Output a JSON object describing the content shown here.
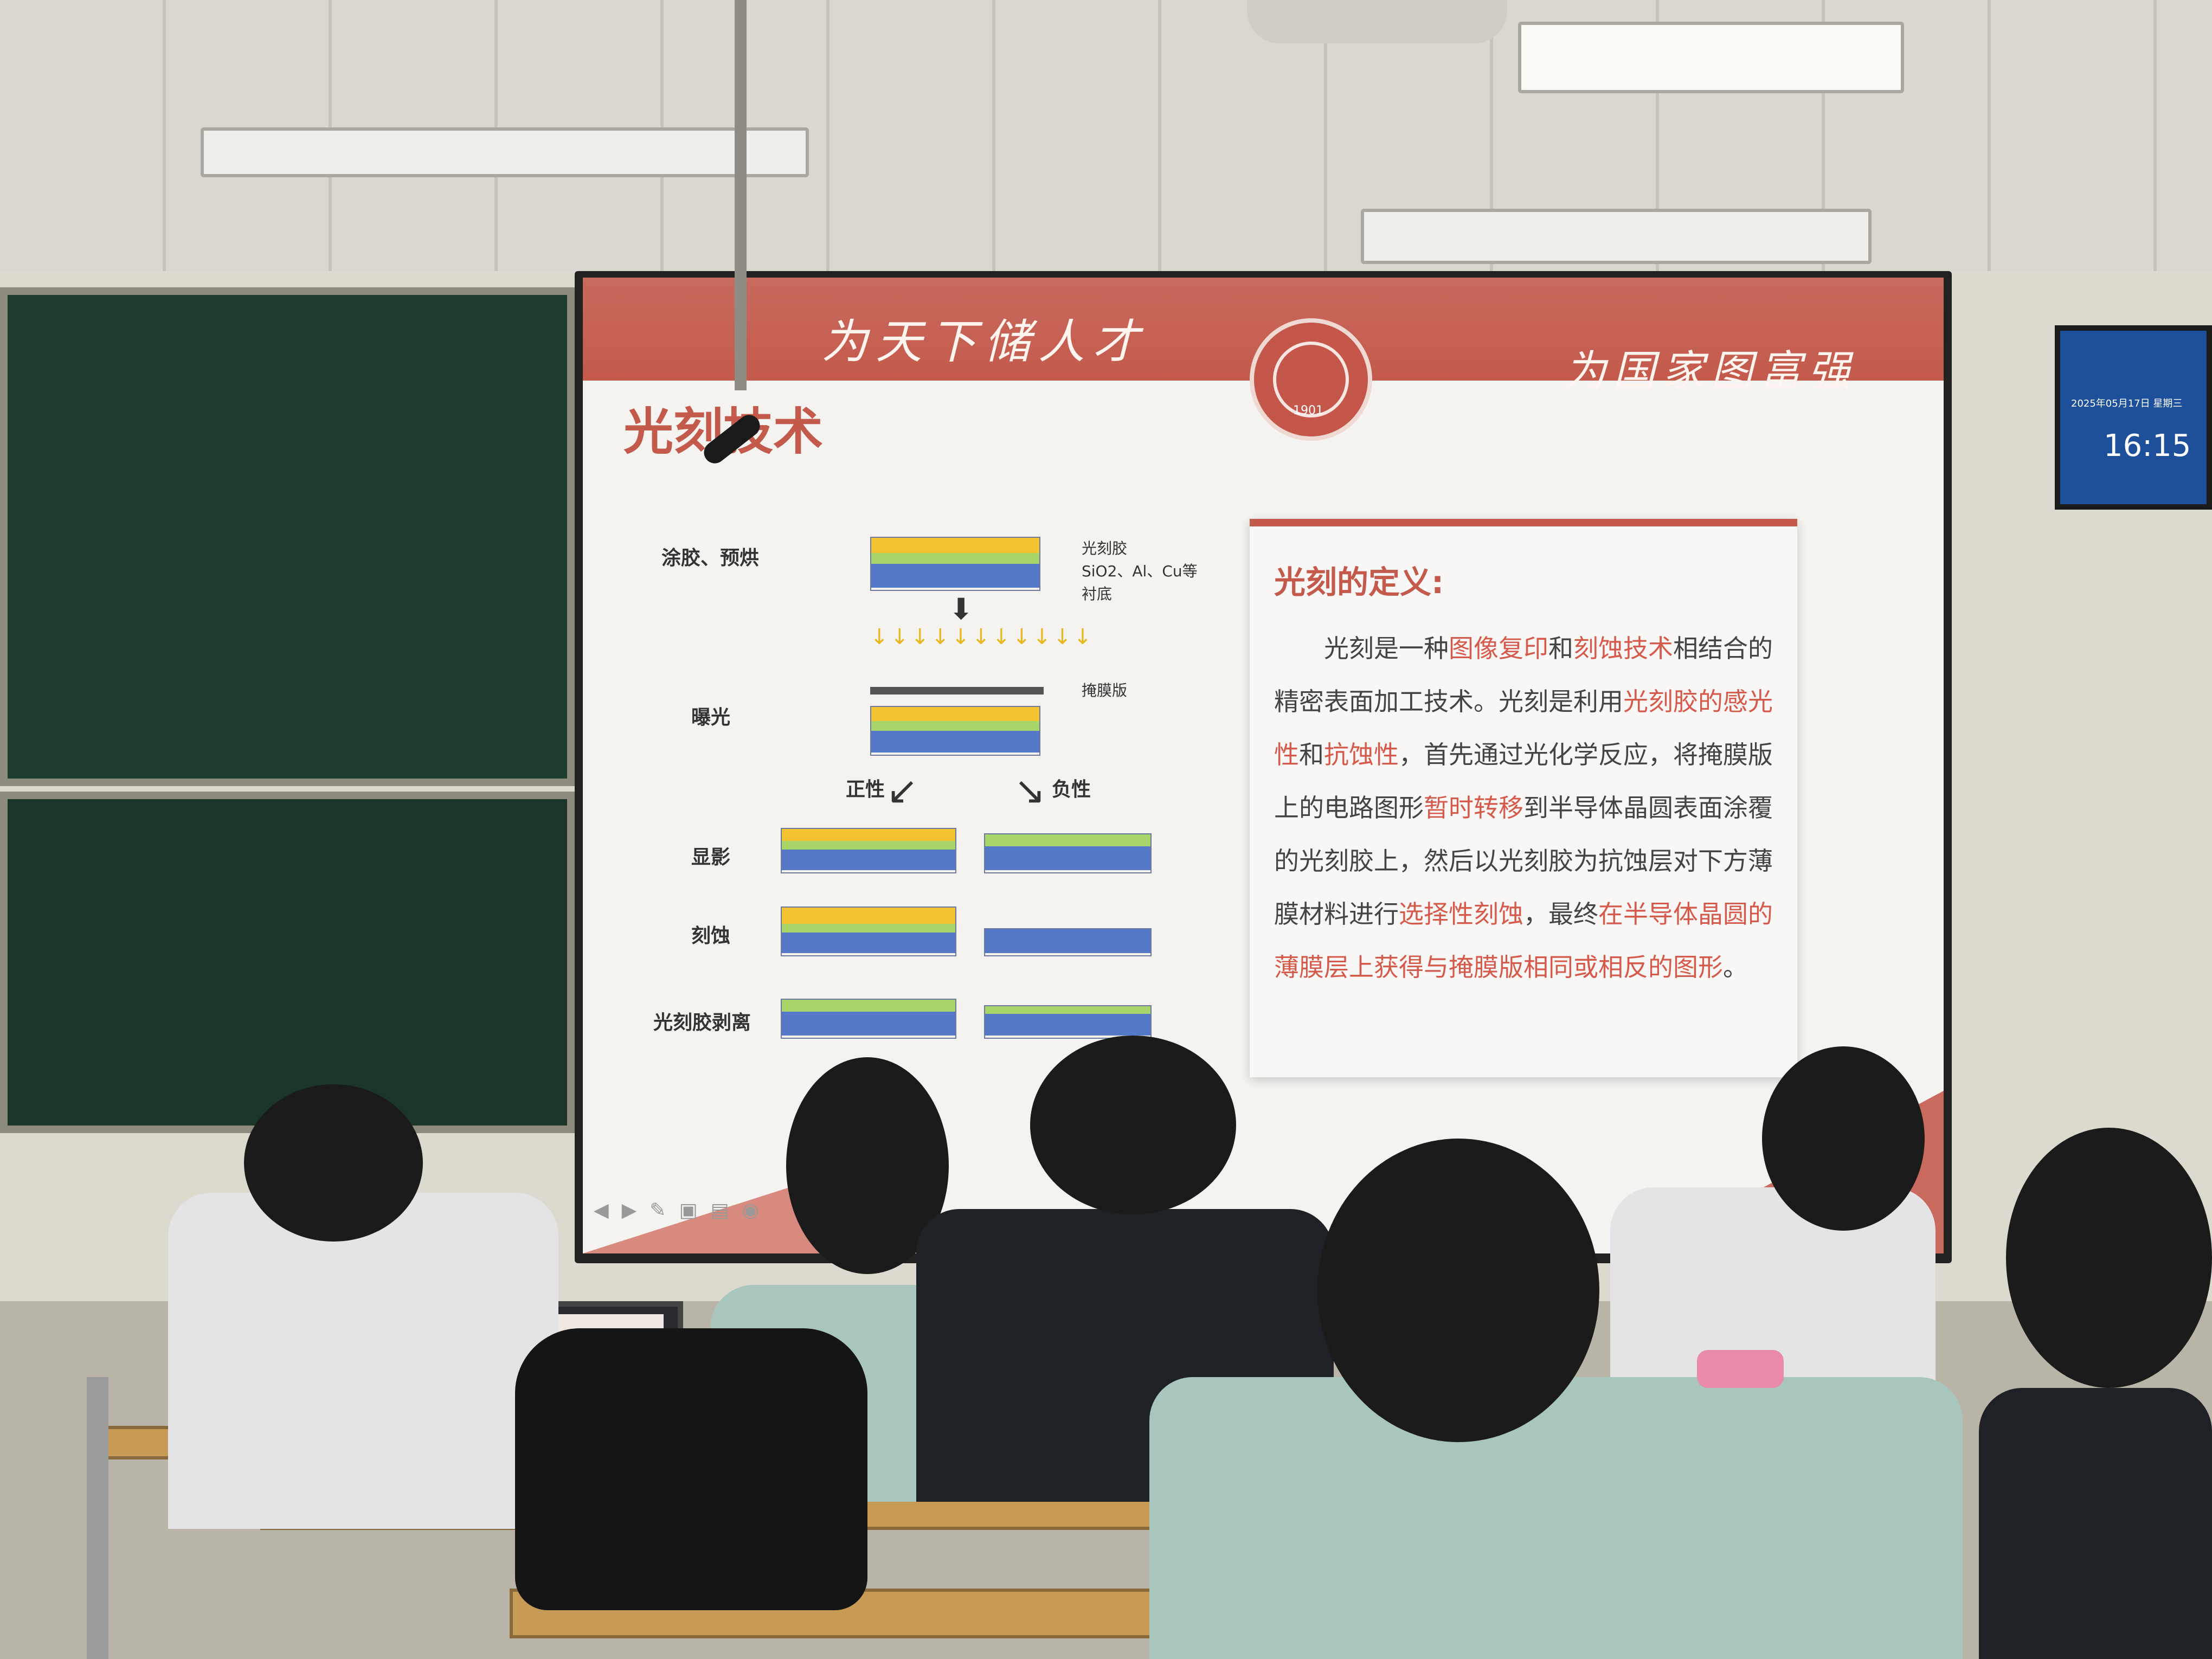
{
  "slide": {
    "banner_left": "为天下储人才",
    "banner_right": "为国家图富强",
    "seal_year": "1901",
    "title": "光刻技术",
    "steps": {
      "coat": "涂胶、预烘",
      "expose": "曝光",
      "develop": "显影",
      "etch": "刻蚀",
      "strip": "光刻胶剥离",
      "positive": "正性",
      "negative": "负性"
    },
    "annotations": {
      "photoresist": "光刻胶",
      "layer": "SiO2、Al、Cu等",
      "substrate": "衬底",
      "mask": "掩膜版"
    },
    "definition": {
      "heading": "光刻的定义:",
      "p1": "光刻是一种",
      "h1": "图像复印",
      "p2": "和",
      "h2": "刻蚀技术",
      "p3": "相结合的精密表面加工技术。光刻是利用",
      "h3": "光刻胶的感光性",
      "p4": "和",
      "h4": "抗蚀性",
      "p5": "，首先通过光化学反应，将掩膜版上的电路图形",
      "h5": "暂时转移",
      "p6": "到半导体晶圆表面涂覆的光刻胶上，然后以光刻胶为抗蚀层对下方薄膜材料进行",
      "h6": "选择性刻蚀",
      "p7": "，最终",
      "h7": "在半导体晶圆的薄膜层上获得与掩膜版相同或相反的图形",
      "p8": "。"
    }
  },
  "clock": {
    "date": "2025年05月17日 星期三",
    "time": "16:15"
  },
  "colors": {
    "accent": "#c45a4c",
    "resist": "#f2c230",
    "film": "#a8d56a",
    "substrate": "#5578c8"
  }
}
